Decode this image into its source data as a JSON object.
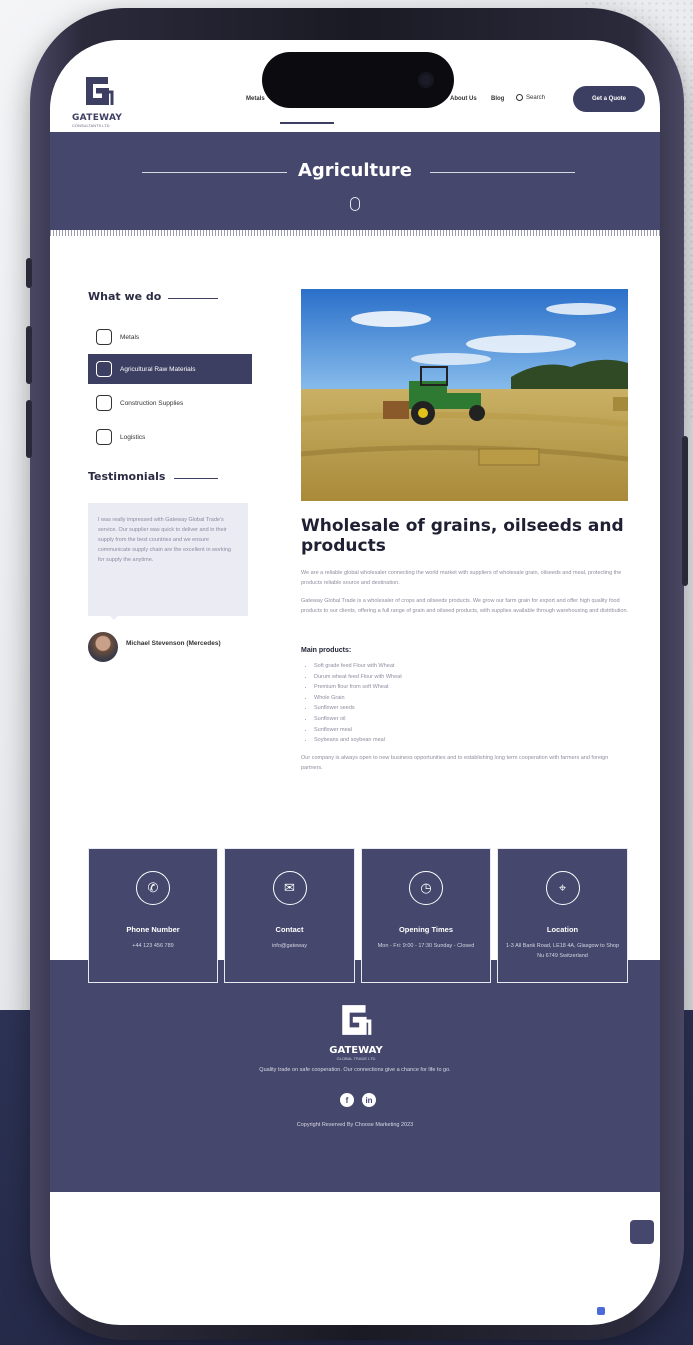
{
  "colors": {
    "brand": "#46476c",
    "brand_dark": "#3d3f62",
    "page_bg_bottom": "#2d3356"
  },
  "header": {
    "logo_name": "GATEWAY",
    "logo_sub": "CONSULTANTS LTD",
    "nav": {
      "first": "Metals",
      "about": "About Us",
      "blog": "Blog",
      "search": "Search"
    },
    "quote_button": "Get a Quote"
  },
  "banner": {
    "title": "Agriculture",
    "icon": "leaf-icon"
  },
  "sidebar": {
    "what_we_do_title": "What we do",
    "items": [
      {
        "label": "Metals",
        "icon": "metals-icon"
      },
      {
        "label": "Agricultural Raw Materials",
        "icon": "plant-icon"
      },
      {
        "label": "Construction Supplies",
        "icon": "building-icon"
      },
      {
        "label": "Logistics",
        "icon": "logistics-icon"
      }
    ],
    "testimonials_title": "Testimonials",
    "testimonial_text": "I was really impressed with Gateway Global Trade's service. Our supplier was quick to deliver and in their supply from the best countries and we ensure communicate supply chain are the excellent in working for supply the anytime.",
    "testimonial_author": "Michael Stevenson (Mercedes)"
  },
  "main": {
    "title": "Wholesale of grains, oilseeds and products",
    "para1": "We are a reliable global wholesaler connecting the world market with suppliers of wholesale grain, oilseeds and meal, protecting the products reliable source and destination.",
    "para2": "Gateway Global Trade is a wholesaler of crops and oilseeds products. We grow our farm grain for export and offer high quality food products to our clients, offering a full range of grain and oilseed products, with supplies available through warehousing and distribution.",
    "main_products_label": "Main products:",
    "products": [
      "Soft grade feed Flour with Wheat",
      "Durum wheat feed Flour with Wheat",
      "Premium flour from soft Wheat",
      "Whole Grain",
      "Sunflower seeds",
      "Sunflower oil",
      "Sunflower meal",
      "Soybeans and soybean meal"
    ],
    "para3": "Our company is always open to new business opportunities and to establishing long term cooperation with farmers and foreign partners."
  },
  "contact_cards": [
    {
      "title": "Phone Number",
      "value": "+44 123 456 789",
      "icon": "phone-icon",
      "glyph": "✆"
    },
    {
      "title": "Contact",
      "value": "info@gateway",
      "icon": "email-icon",
      "glyph": "✉"
    },
    {
      "title": "Opening Times",
      "value": "Mon - Fri: 9:00 - 17:30 Sunday - Closed",
      "icon": "clock-icon",
      "glyph": "◷"
    },
    {
      "title": "Location",
      "value": "1-3 All Bank Road, LE18 4A, Glasgow to Shop Nu 6749 Switzerland",
      "icon": "location-icon",
      "glyph": "⌖"
    }
  ],
  "footer": {
    "name": "GATEWAY",
    "sub": "GLOBAL TRADE LTD",
    "tagline": "Quality trade on safe cooperation. Our connections give a chance for life to go.",
    "social": [
      "f",
      "in"
    ],
    "copyright": "Copyright Reserved By Choose Marketing 2023"
  }
}
